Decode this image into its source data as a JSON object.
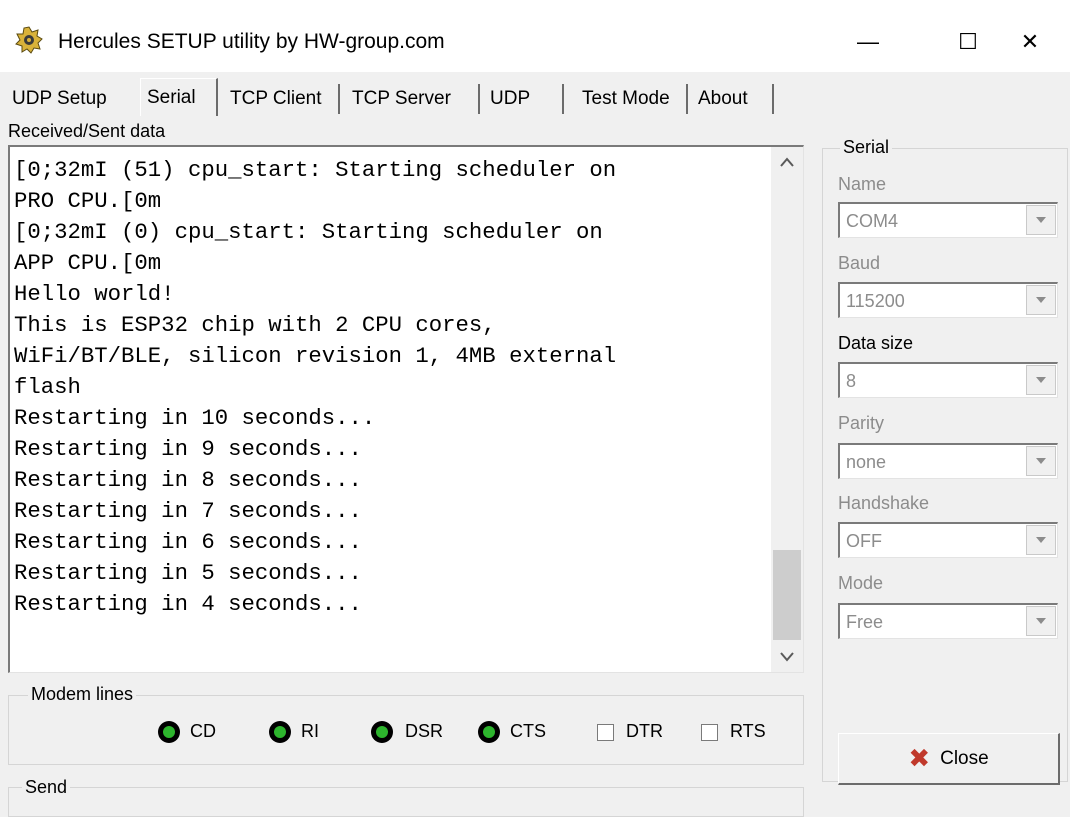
{
  "window": {
    "title": "Hercules SETUP utility by HW-group.com",
    "controls": {
      "minimize": "—",
      "maximize": "☐",
      "close": "✕"
    }
  },
  "tabs": [
    {
      "label": "UDP Setup"
    },
    {
      "label": "Serial",
      "active": true
    },
    {
      "label": "TCP Client"
    },
    {
      "label": "TCP Server"
    },
    {
      "label": "UDP"
    },
    {
      "label": "Test Mode"
    },
    {
      "label": "About"
    }
  ],
  "received": {
    "label": "Received/Sent data",
    "text": "[0;32mI (51) cpu_start: Starting scheduler on\nPRO CPU.[0m\n[0;32mI (0) cpu_start: Starting scheduler on\nAPP CPU.[0m\nHello world!\nThis is ESP32 chip with 2 CPU cores,\nWiFi/BT/BLE, silicon revision 1, 4MB external\nflash\nRestarting in 10 seconds...\nRestarting in 9 seconds...\nRestarting in 8 seconds...\nRestarting in 7 seconds...\nRestarting in 6 seconds...\nRestarting in 5 seconds...\nRestarting in 4 seconds..."
  },
  "modem": {
    "title": "Modem lines",
    "leds": [
      {
        "label": "CD"
      },
      {
        "label": "RI"
      },
      {
        "label": "DSR"
      },
      {
        "label": "CTS"
      }
    ],
    "checks": [
      {
        "label": "DTR",
        "checked": false
      },
      {
        "label": "RTS",
        "checked": false
      }
    ]
  },
  "send": {
    "title": "Send"
  },
  "serial": {
    "title": "Serial",
    "name": {
      "label": "Name",
      "value": "COM4"
    },
    "baud": {
      "label": "Baud",
      "value": "115200"
    },
    "datasize": {
      "label": "Data size",
      "value": "8"
    },
    "parity": {
      "label": "Parity",
      "value": "none"
    },
    "handshake": {
      "label": "Handshake",
      "value": "OFF"
    },
    "mode": {
      "label": "Mode",
      "value": "Free"
    },
    "close_label": "Close"
  },
  "colors": {
    "led_on": "#2db52d",
    "disabled_text": "#8c8c8c",
    "close_icon": "#c0392b"
  }
}
